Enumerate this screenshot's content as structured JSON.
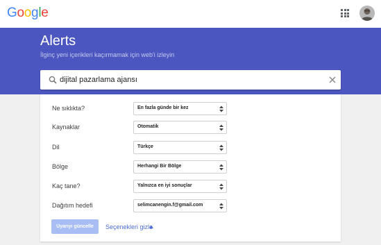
{
  "header": {
    "logo_letters": [
      {
        "char": "G",
        "color": "#4285F4"
      },
      {
        "char": "o",
        "color": "#EA4335"
      },
      {
        "char": "o",
        "color": "#FBBC05"
      },
      {
        "char": "g",
        "color": "#4285F4"
      },
      {
        "char": "l",
        "color": "#34A853"
      },
      {
        "char": "e",
        "color": "#EA4335"
      }
    ],
    "apps_icon": "apps-grid-icon",
    "avatar_icon": "user-avatar"
  },
  "hero": {
    "title": "Alerts",
    "subtitle": "İlginç yeni içerikleri kaçırmamak için web'i izleyin",
    "background": "#4c56c0"
  },
  "search": {
    "value": "dijital pazarlama ajansı",
    "search_icon": "search-icon",
    "clear_icon": "close-icon"
  },
  "options": [
    {
      "label": "Ne sıklıkta?",
      "value": "En fazla günde bir kez"
    },
    {
      "label": "Kaynaklar",
      "value": "Otomatik"
    },
    {
      "label": "Dil",
      "value": "Türkçe"
    },
    {
      "label": "Bölge",
      "value": "Herhangi Bir Bölge"
    },
    {
      "label": "Kaç tane?",
      "value": "Yalnızca en iyi sonuçlar"
    },
    {
      "label": "Dağıtım hedefi",
      "value": "selimcanengin.f@gmail.com"
    }
  ],
  "actions": {
    "update_label": "Uyarıyı güncelle",
    "toggle_label": "Seçenekleri gizle",
    "accent": "#4c6dd6",
    "button_color": "#a7bdf3"
  }
}
